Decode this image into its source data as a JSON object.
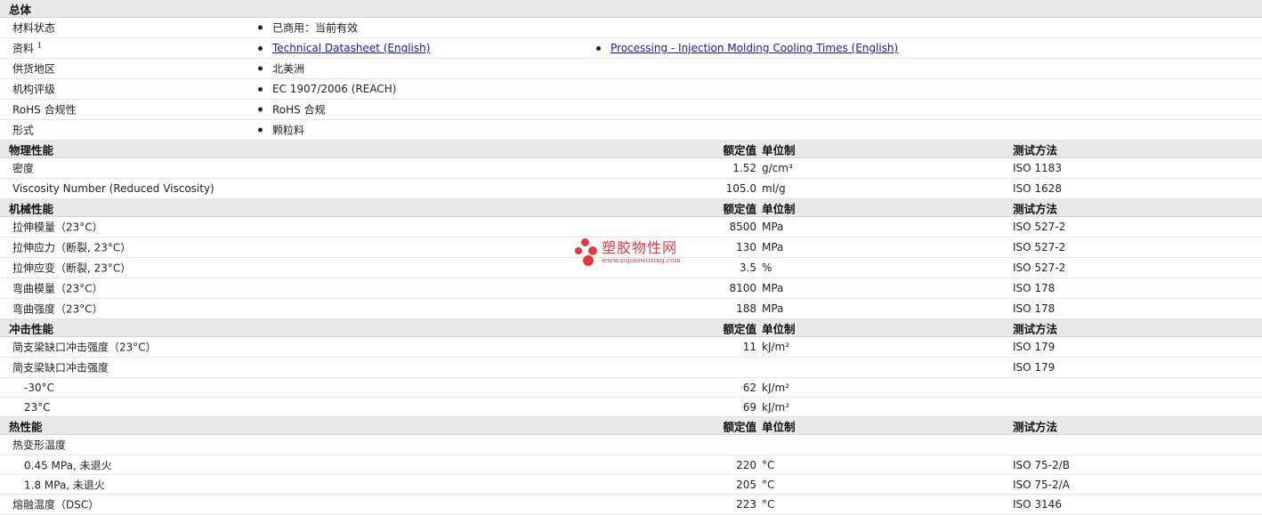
{
  "general": {
    "title": "总体",
    "rows": [
      {
        "label": "材料状态",
        "values": [
          {
            "text": "已商用：当前有效",
            "link": false
          }
        ]
      },
      {
        "label": "资料",
        "sup": "1",
        "values": [
          {
            "text": "Technical Datasheet (English)",
            "link": true
          },
          {
            "text": "Processing - Injection Molding Cooling Times (English)",
            "link": true
          }
        ]
      },
      {
        "label": "供货地区",
        "values": [
          {
            "text": "北美洲",
            "link": false
          }
        ]
      },
      {
        "label": "机构评级",
        "values": [
          {
            "text": "EC 1907/2006 (REACH)",
            "link": false
          }
        ]
      },
      {
        "label": "RoHS 合规性",
        "values": [
          {
            "text": "RoHS 合规",
            "link": false
          }
        ]
      },
      {
        "label": "形式",
        "values": [
          {
            "text": "颗粒料",
            "link": false
          }
        ]
      }
    ]
  },
  "sections": [
    {
      "title": "物理性能",
      "h_value": "额定值",
      "h_unit": "单位制",
      "h_test": "测试方法",
      "rows": [
        {
          "label": "密度",
          "value": "1.52",
          "unit": "g/cm³",
          "test": "ISO 1183"
        },
        {
          "label": "Viscosity Number (Reduced Viscosity)",
          "value": "105.0",
          "unit": "ml/g",
          "test": "ISO 1628"
        }
      ]
    },
    {
      "title": "机械性能",
      "h_value": "额定值",
      "h_unit": "单位制",
      "h_test": "测试方法",
      "rows": [
        {
          "label": "拉伸模量（23°C）",
          "value": "8500",
          "unit": "MPa",
          "test": "ISO 527-2"
        },
        {
          "label": "拉伸应力（断裂, 23°C）",
          "value": "130",
          "unit": "MPa",
          "test": "ISO 527-2"
        },
        {
          "label": "拉伸应变（断裂, 23°C）",
          "value": "3.5",
          "unit": "%",
          "test": "ISO 527-2"
        },
        {
          "label": "弯曲模量（23°C）",
          "value": "8100",
          "unit": "MPa",
          "test": "ISO 178"
        },
        {
          "label": "弯曲强度（23°C）",
          "value": "188",
          "unit": "MPa",
          "test": "ISO 178"
        }
      ]
    },
    {
      "title": "冲击性能",
      "h_value": "额定值",
      "h_unit": "单位制",
      "h_test": "测试方法",
      "rows": [
        {
          "label": "简支梁缺口冲击强度（23°C）",
          "value": "11",
          "unit": "kJ/m²",
          "test": "ISO 179"
        },
        {
          "label": "简支梁缺口冲击强度",
          "value": "",
          "unit": "",
          "test": "ISO 179"
        },
        {
          "label": "-30°C",
          "value": "62",
          "unit": "kJ/m²",
          "test": "",
          "indent": true
        },
        {
          "label": "23°C",
          "value": "69",
          "unit": "kJ/m²",
          "test": "",
          "indent": true
        }
      ]
    },
    {
      "title": "热性能",
      "h_value": "额定值",
      "h_unit": "单位制",
      "h_test": "测试方法",
      "rows": [
        {
          "label": "热变形温度",
          "value": "",
          "unit": "",
          "test": ""
        },
        {
          "label": "0.45 MPa, 未退火",
          "value": "220",
          "unit": "°C",
          "test": "ISO 75-2/B",
          "indent": true
        },
        {
          "label": "1.8 MPa, 未退火",
          "value": "205",
          "unit": "°C",
          "test": "ISO 75-2/A",
          "indent": true
        },
        {
          "label": "熔融温度（DSC）",
          "value": "223",
          "unit": "°C",
          "test": "ISO 3146"
        }
      ]
    }
  ],
  "watermark": {
    "cn": "塑胶物性网",
    "url": "www.sujiaowuxing.com",
    "color": "#e3222b"
  }
}
